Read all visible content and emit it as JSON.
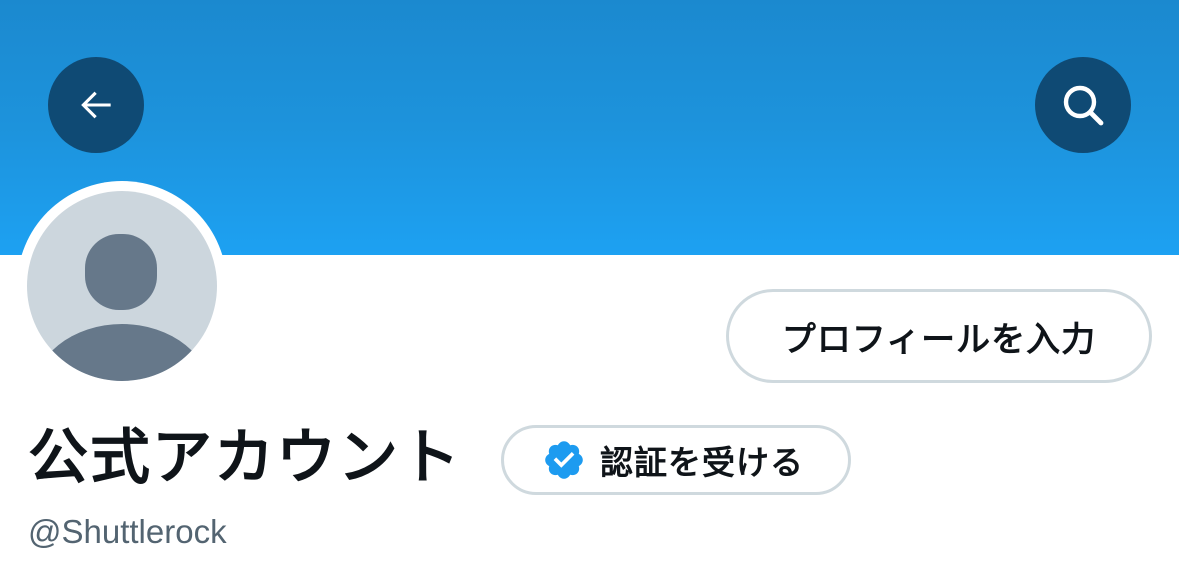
{
  "header": {
    "back_icon": "arrow-left-icon",
    "search_icon": "search-icon",
    "banner_color": "#1da1f2",
    "button_color": "#0f4a74"
  },
  "profile": {
    "avatar_icon": "default-avatar-icon",
    "edit_profile_label": "プロフィールを入力",
    "display_name": "公式アカウント",
    "verify_label": "認証を受ける",
    "verify_icon": "verified-badge-icon",
    "handle": "@Shuttlerock",
    "verified_color": "#1d9bf0"
  }
}
